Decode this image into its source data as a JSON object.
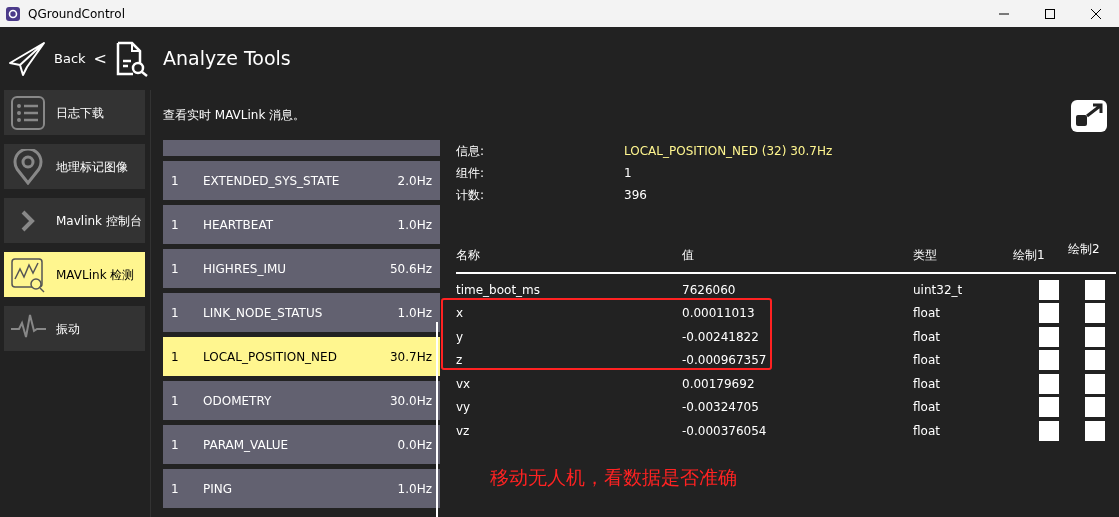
{
  "window": {
    "title": "QGroundControl"
  },
  "header": {
    "back": "Back",
    "separator": "<",
    "title": "Analyze Tools"
  },
  "sidebar": {
    "items": [
      {
        "label": "日志下载",
        "selected": false
      },
      {
        "label": "地理标记图像",
        "selected": false
      },
      {
        "label": "Mavlink 控制台",
        "selected": false
      },
      {
        "label": "MAVLink 检测",
        "selected": true
      },
      {
        "label": "振动",
        "selected": false
      }
    ]
  },
  "description": "查看实时 MAVLink 消息。",
  "messages": [
    {
      "component": "1",
      "name": "EXTENDED_SYS_STATE",
      "rate": "2.0Hz",
      "selected": false
    },
    {
      "component": "1",
      "name": "HEARTBEAT",
      "rate": "1.0Hz",
      "selected": false
    },
    {
      "component": "1",
      "name": "HIGHRES_IMU",
      "rate": "50.6Hz",
      "selected": false
    },
    {
      "component": "1",
      "name": "LINK_NODE_STATUS",
      "rate": "1.0Hz",
      "selected": false
    },
    {
      "component": "1",
      "name": "LOCAL_POSITION_NED",
      "rate": "30.7Hz",
      "selected": true
    },
    {
      "component": "1",
      "name": "ODOMETRY",
      "rate": "30.0Hz",
      "selected": false
    },
    {
      "component": "1",
      "name": "PARAM_VALUE",
      "rate": "0.0Hz",
      "selected": false
    },
    {
      "component": "1",
      "name": "PING",
      "rate": "1.0Hz",
      "selected": false
    }
  ],
  "info": [
    {
      "label": "信息:",
      "value": "LOCAL_POSITION_NED (32) 30.7Hz",
      "highlight": true
    },
    {
      "label": "组件:",
      "value": "1",
      "highlight": false
    },
    {
      "label": "计数:",
      "value": "396",
      "highlight": false
    }
  ],
  "table": {
    "columns": [
      "名称",
      "值",
      "类型",
      "绘制1",
      "绘制2"
    ],
    "rows": [
      {
        "name": "time_boot_ms",
        "value": "7626060",
        "type": "uint32_t",
        "plot1": false,
        "plot2": false
      },
      {
        "name": "x",
        "value": "0.00011013",
        "type": "float",
        "plot1": false,
        "plot2": false
      },
      {
        "name": "y",
        "value": "-0.00241822",
        "type": "float",
        "plot1": false,
        "plot2": false
      },
      {
        "name": "z",
        "value": "-0.000967357",
        "type": "float",
        "plot1": false,
        "plot2": false
      },
      {
        "name": "vx",
        "value": "0.00179692",
        "type": "float",
        "plot1": false,
        "plot2": false
      },
      {
        "name": "vy",
        "value": "-0.00324705",
        "type": "float",
        "plot1": false,
        "plot2": false
      },
      {
        "name": "vz",
        "value": "-0.000376054",
        "type": "float",
        "plot1": false,
        "plot2": false
      }
    ]
  },
  "annotation": {
    "text": "移动无人机，看数据是否准确"
  }
}
